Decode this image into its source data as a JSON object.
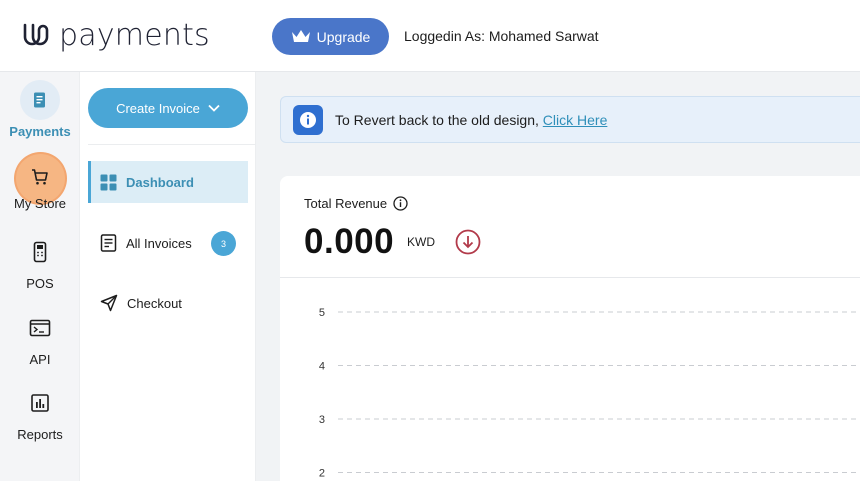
{
  "brand": {
    "name": "payments"
  },
  "header": {
    "upgrade_label": "Upgrade",
    "logged_in_text": "Loggedin As: Mohamed Sarwat"
  },
  "rail": {
    "items": [
      {
        "label": "Payments",
        "icon": "document-icon",
        "active": true
      },
      {
        "label": "My Store",
        "icon": "cart-icon"
      },
      {
        "label": "POS",
        "icon": "pos-terminal-icon"
      },
      {
        "label": "API",
        "icon": "terminal-icon"
      },
      {
        "label": "Reports",
        "icon": "bar-chart-icon"
      }
    ]
  },
  "subnav": {
    "create_label": "Create Invoice",
    "items": [
      {
        "label": "Dashboard",
        "icon": "grid-icon",
        "active": true
      },
      {
        "label": "All Invoices",
        "icon": "invoice-icon",
        "badge": "3"
      },
      {
        "label": "Checkout",
        "icon": "send-icon"
      }
    ]
  },
  "banner": {
    "text": "To Revert back to the old design,",
    "link_text": "Click Here"
  },
  "revenue": {
    "label": "Total Revenue",
    "value": "0.000",
    "unit": "KWD",
    "trend": "down"
  },
  "chart_data": {
    "type": "line",
    "y_ticks": [
      "5",
      "4",
      "3",
      "2"
    ],
    "grid": "dashed"
  },
  "colors": {
    "accent": "#4aa6d6",
    "upgrade": "#4a76c9",
    "trend_down": "#b23a4a"
  }
}
